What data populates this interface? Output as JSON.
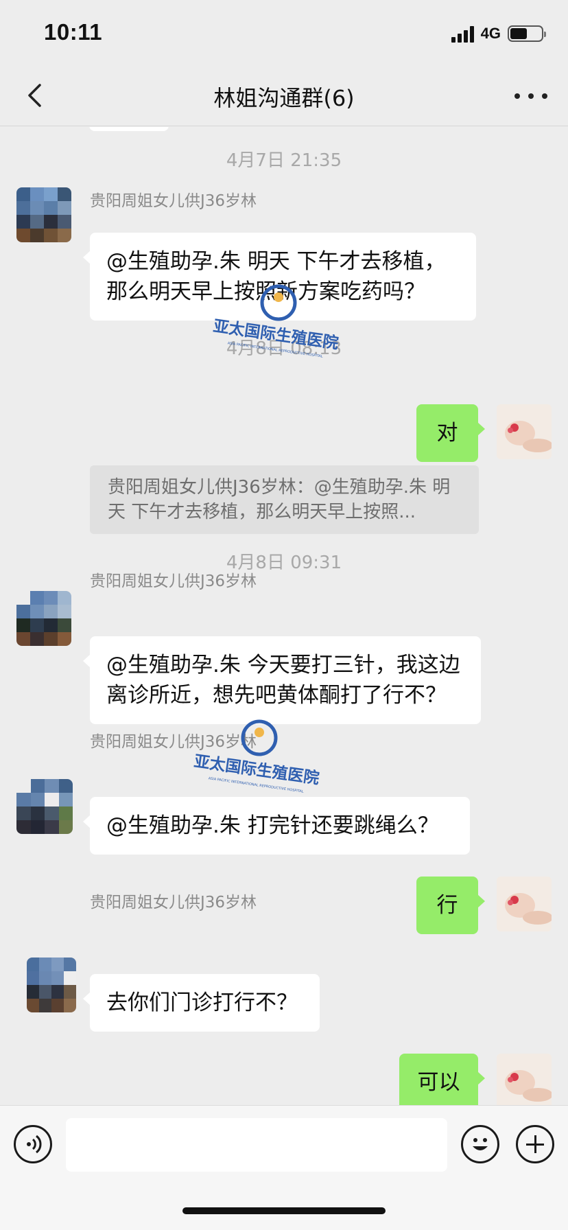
{
  "status_bar": {
    "time": "10:11",
    "network": "4G"
  },
  "nav": {
    "title": "林姐沟通群(6)"
  },
  "messages": [
    {
      "type": "time",
      "text": "4月7日 21:35"
    },
    {
      "type": "in",
      "sender": "贵阳周姐女儿供J36岁林",
      "text": "@生殖助孕.朱 明天 下午才去移植，那么明天早上按照新方案吃药吗？"
    },
    {
      "type": "time",
      "text": "4月8日 08:13"
    },
    {
      "type": "out",
      "text": "对"
    },
    {
      "type": "quote",
      "text": "贵阳周姐女儿供J36岁林：@生殖助孕.朱 明天 下午才去移植，那么明天早上按照..."
    },
    {
      "type": "time",
      "text": "4月8日 09:31"
    },
    {
      "type": "in",
      "sender": "贵阳周姐女儿供J36岁林",
      "text": "@生殖助孕.朱 今天要打三针，我这边离诊所近，想先吧黄体酮打了行不？"
    },
    {
      "type": "in",
      "sender": "贵阳周姐女儿供J36岁林",
      "text": "@生殖助孕.朱 打完针还要跳绳么？"
    },
    {
      "type": "out",
      "text": "行"
    },
    {
      "type": "in",
      "sender": "贵阳周姐女儿供J36岁林",
      "text": "去你们门诊打行不？"
    },
    {
      "type": "out",
      "text": "可以"
    }
  ],
  "watermark": {
    "name": "亚太国际生殖医院",
    "subtitle": "ASIA PACIFIC INTERNATIONAL REPRODUCTIVE HOSPITAL"
  },
  "input": {
    "placeholder": ""
  },
  "colors": {
    "background": "#ededed",
    "incoming_bubble": "#ffffff",
    "outgoing_bubble": "#95ec69",
    "watermark": "#2f5fb0"
  }
}
